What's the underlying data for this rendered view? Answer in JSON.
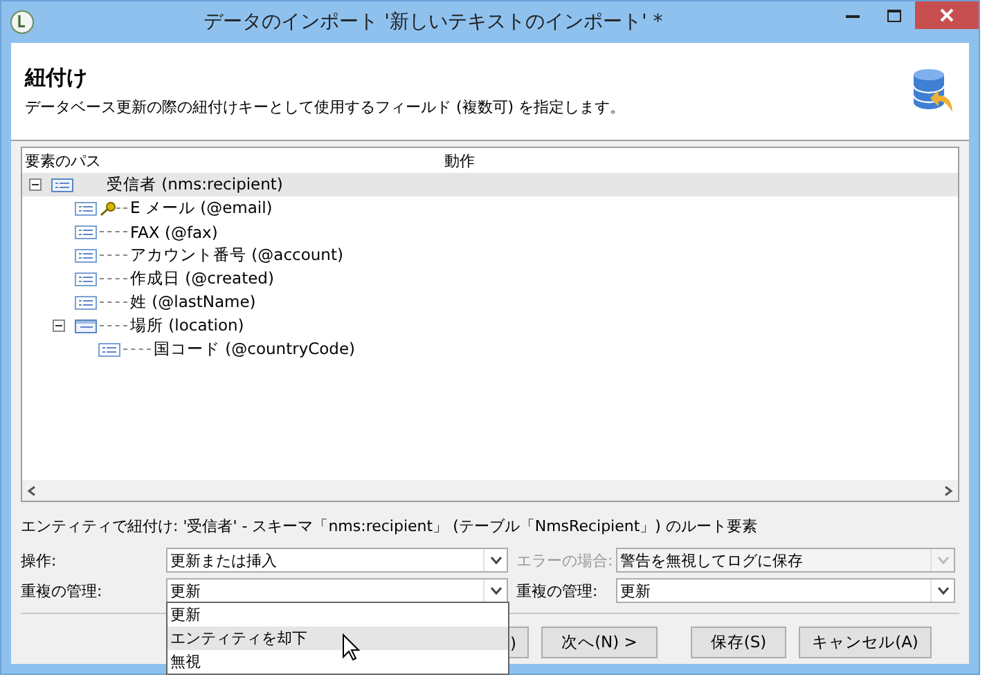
{
  "window": {
    "title": "データのインポート '新しいテキストのインポート' *"
  },
  "header": {
    "title": "紐付け",
    "description": "データベース更新の際の紐付けキーとして使用するフィールド (複数可) を指定します。"
  },
  "tree": {
    "columns": [
      "要素のパス",
      "動作"
    ],
    "nodes": [
      {
        "label": "受信者 (nms:recipient)",
        "kind": "element",
        "expanded": true,
        "selected": true,
        "children": [
          {
            "label": "E メール (@email)",
            "kind": "attribute",
            "key": true,
            "selected": false
          },
          {
            "label": "FAX (@fax)",
            "kind": "attribute",
            "key": false,
            "selected": false
          },
          {
            "label": "アカウント番号 (@account)",
            "kind": "attribute",
            "key": false,
            "selected": false
          },
          {
            "label": "作成日 (@created)",
            "kind": "attribute",
            "key": false,
            "selected": false
          },
          {
            "label": "姓 (@lastName)",
            "kind": "attribute",
            "key": false,
            "selected": false
          },
          {
            "label": "場所 (location)",
            "kind": "link",
            "expanded": true,
            "selected": false,
            "children": [
              {
                "label": "国コード (@countryCode)",
                "kind": "attribute",
                "key": false,
                "selected": false
              }
            ]
          }
        ]
      }
    ]
  },
  "info": "エンティティで紐付け: '受信者' - スキーマ「nms:recipient」 (テーブル「NmsRecipient」) のルート要素",
  "form": [
    [
      {
        "label": "操作:",
        "value": "更新または挿入",
        "disabled": false
      },
      {
        "label": "エラーの場合:",
        "value": "警告を無視してログに保存",
        "disabled": true
      }
    ],
    [
      {
        "label": "重複の管理:",
        "value": "更新",
        "disabled": false
      },
      {
        "label": "重複の管理:",
        "value": "更新",
        "disabled": false
      }
    ]
  ],
  "dropdown": {
    "options": [
      {
        "label": "更新",
        "selected": false
      },
      {
        "label": "エンティティを却下",
        "selected": true
      },
      {
        "label": "無視",
        "selected": false
      }
    ]
  },
  "buttons": [
    ")",
    "次へ(N) >",
    "保存(S)",
    "キャンセル(A)"
  ]
}
